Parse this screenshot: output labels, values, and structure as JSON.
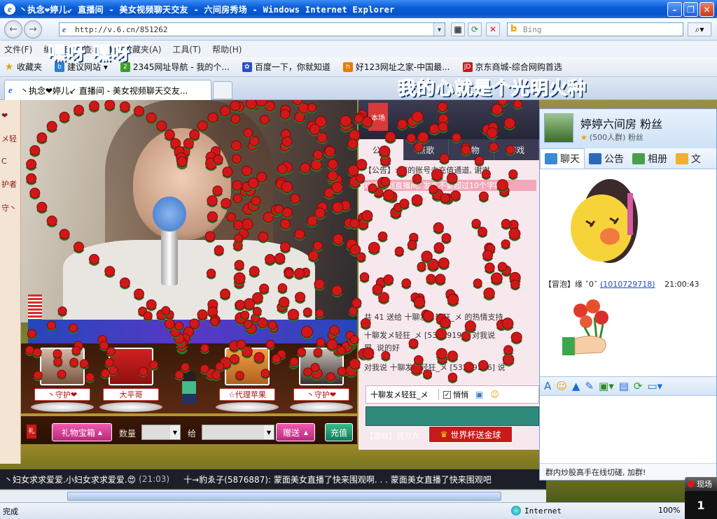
{
  "window": {
    "title": "丶执念❤婷儿↙ 直播间 - 美女视频聊天交友 - 六间房秀场 - Windows Internet Explorer",
    "minimize": "–",
    "maximize": "❐",
    "close": "✕"
  },
  "address": {
    "url": "http://v.6.cn/851262",
    "search_placeholder": "Bing"
  },
  "menu": [
    "文件(F)",
    "编辑(E)",
    "查看(V)",
    "收藏夹(A)",
    "工具(T)",
    "帮助(H)"
  ],
  "overlay": {
    "text1": "嘿呀 嘿呀",
    "text2": "我的心就是个光明火种"
  },
  "favorites": {
    "label": "收藏夹",
    "items": [
      "建议网站 ▾",
      "2345网址导航 - 我的个...",
      "百度一下，你就知道",
      "好123网址之家-中国最...",
      "京东商城-综合网购首选"
    ]
  },
  "tab": {
    "title": "丶执念❤婷儿↙ 直播间 - 美女视频聊天交友..."
  },
  "left_strip": [
    "❤",
    "メ轻",
    "C",
    "护者",
    "守丶"
  ],
  "guards": [
    {
      "label": "丶守护❤"
    },
    {
      "label": "大平哥"
    },
    {
      "label": "☆代理苹果"
    },
    {
      "label": "丶守护❤"
    }
  ],
  "giftbar": {
    "gift_box": "礼物宝箱",
    "quantity": "数量",
    "give": "给",
    "send": "赠送",
    "charge": "充值"
  },
  "chat": {
    "room_tab": "本场",
    "tabs": [
      "公聊",
      "点歌",
      "礼物",
      "游戏"
    ],
    "messages": [
      {
        "text": "【公告】: 您的账号未充值通道, 谢谢"
      },
      {
        "text": "欢迎来到直播间, 发言不要超过10个字哦"
      },
      {
        "text": "共 41 送给 十聊发メ轻狂_メ 的热情支持"
      },
      {
        "text": "十聊发メ轻狂_メ [53289196] 对我说"
      },
      {
        "text": "屏, 说的好"
      },
      {
        "text": "对我说 十聊发メ轻狂_メ [53289196] 说"
      }
    ],
    "target": "十聊发メ轻狂_メ",
    "whisper": "悄悄",
    "game_line": "【游戏】百万六",
    "world_cup": "世界杯送金球"
  },
  "marquee": {
    "msg1": "丶妇女求求爱爱.小妇女求求爱爱.😍",
    "time1": "(21:03)",
    "msg2": "十→豹ゑ子(5876887): 蒙面美女直播了快来围观啊. . . 蒙面美女直播了快来围观吧"
  },
  "qq": {
    "group_name": "婷婷六间房 粉丝",
    "group_sub": "(500人群) 粉丝",
    "tabs": [
      "聊天",
      "公告",
      "相册",
      "文"
    ],
    "sender_name": "【冒泡】缘 ˆ0ˆ",
    "sender_id": "(1010729718)",
    "sender_time": "21:00:43",
    "footer": "群内炒股高手在线切磋, 加群!"
  },
  "notify": {
    "text": "现场"
  },
  "status": {
    "left": "完成",
    "zone": "Internet",
    "zoom": "100%"
  },
  "colors": {
    "title_blue": "#0553c9",
    "rose_red": "#d01818",
    "gift_pink": "#c8287a"
  }
}
